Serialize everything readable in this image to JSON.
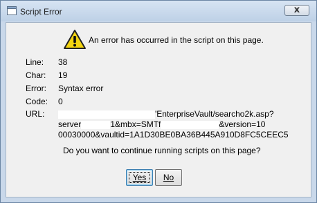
{
  "window": {
    "title": "Script Error",
    "close_glyph": "x",
    "title_bar_color": "#bdd0e6",
    "frame_color": "#c9d8ea"
  },
  "dialog": {
    "message": "An error has occurred in the script on this page.",
    "icon": "warning-icon",
    "details": [
      {
        "label": "Line:",
        "value": "38"
      },
      {
        "label": "Char:",
        "value": "19"
      },
      {
        "label": "Error:",
        "value": "Syntax error"
      },
      {
        "label": "Code:",
        "value": "0"
      }
    ],
    "url": {
      "label": "URL:",
      "line1": "'EnterpriseVault/searcho2k.asp?",
      "line2_a": "server",
      "line2_b": "1&mbx=SMTf",
      "line2_c": "&version=10",
      "line3": "00030000&vaultid=1A1D30BE0BA36B445A910D8FC5CEEC5"
    },
    "question": "Do you want to continue running scripts on this page?",
    "buttons": {
      "yes": "Yes",
      "no": "No"
    }
  }
}
